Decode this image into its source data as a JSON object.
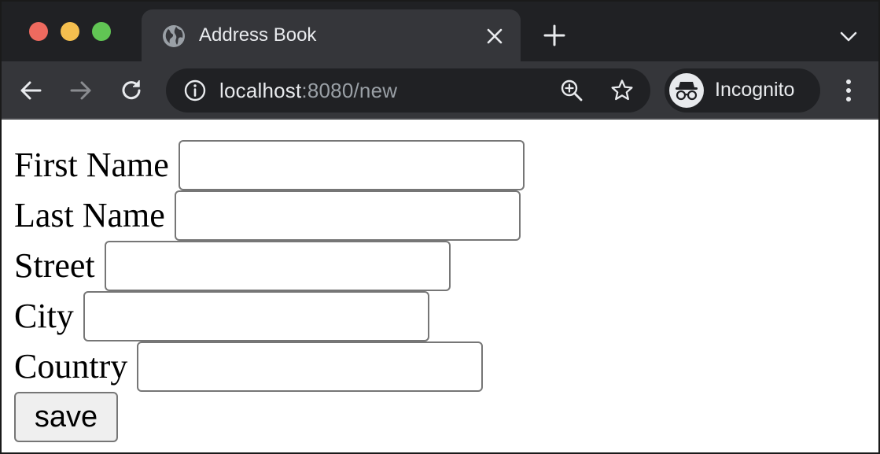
{
  "browser": {
    "tab": {
      "title": "Address Book",
      "favicon": "globe-icon"
    },
    "address_bar": {
      "host": "localhost",
      "path": ":8080/new"
    },
    "profile_label": "Incognito",
    "colors": {
      "tabstrip": "#202124",
      "toolbar": "#35363a",
      "close_light": "#ee6a5f",
      "minimize_light": "#f5bf4f",
      "maximize_light": "#61c554"
    }
  },
  "form": {
    "fields": [
      {
        "label": "First Name",
        "value": "",
        "placeholder": ""
      },
      {
        "label": "Last Name",
        "value": "",
        "placeholder": ""
      },
      {
        "label": "Street",
        "value": "",
        "placeholder": ""
      },
      {
        "label": "City",
        "value": "",
        "placeholder": ""
      },
      {
        "label": "Country",
        "value": "",
        "placeholder": ""
      }
    ],
    "submit_label": "save"
  }
}
